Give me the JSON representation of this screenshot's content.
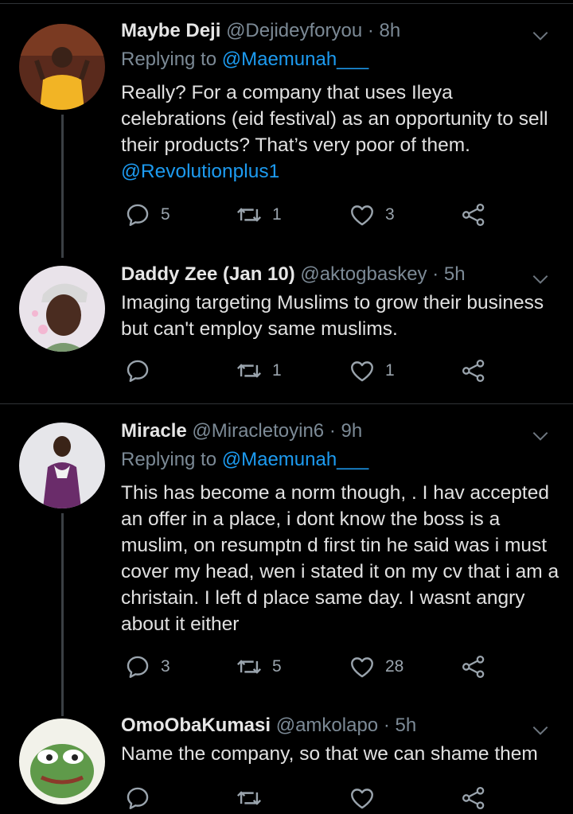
{
  "tweets": [
    {
      "name": "Maybe Deji",
      "handle": "@Dejideyforyou",
      "dot": "·",
      "time": "8h",
      "replying_prefix": "Replying to ",
      "replying_to": "@Maemunah___",
      "text": "Really? For a company that uses Ileya celebrations (eid festival) as an opportunity to sell their products? That’s very poor of them.",
      "text_mention": "@Revolutionplus1",
      "replies": "5",
      "retweets": "1",
      "likes": "3"
    },
    {
      "name": "Daddy Zee (Jan 10)",
      "handle": "@aktogbaskey",
      "dot": "·",
      "time": "5h",
      "text": "Imaging targeting Muslims to grow their business but can't employ same muslims.",
      "replies": "",
      "retweets": "1",
      "likes": "1"
    },
    {
      "name": "Miracle",
      "handle": "@Miracletoyin6",
      "dot": "·",
      "time": "9h",
      "replying_prefix": "Replying to ",
      "replying_to": "@Maemunah___",
      "text": "This has become a norm though, . I hav accepted an offer in a place, i dont know the boss is a muslim, on resumptn d first tin he said was i must cover my head, wen i stated it on my cv that i am a christain. I left d place same day. I wasnt angry about it either",
      "replies": "3",
      "retweets": "5",
      "likes": "28"
    },
    {
      "name": "OmoObaKumasi",
      "handle": "@amkolapo",
      "dot": "·",
      "time": "5h",
      "text": "Name the company, so that we can shame them"
    }
  ],
  "icons": {
    "reply": "reply-icon",
    "retweet": "retweet-icon",
    "like": "heart-icon",
    "share": "share-icon",
    "menu": "chevron-down-icon"
  },
  "colors": {
    "background": "#000000",
    "accent": "#1d9bf0",
    "secondary_text": "#7c8a96",
    "primary_text": "#e1e1e1",
    "divider": "#2f3336"
  }
}
